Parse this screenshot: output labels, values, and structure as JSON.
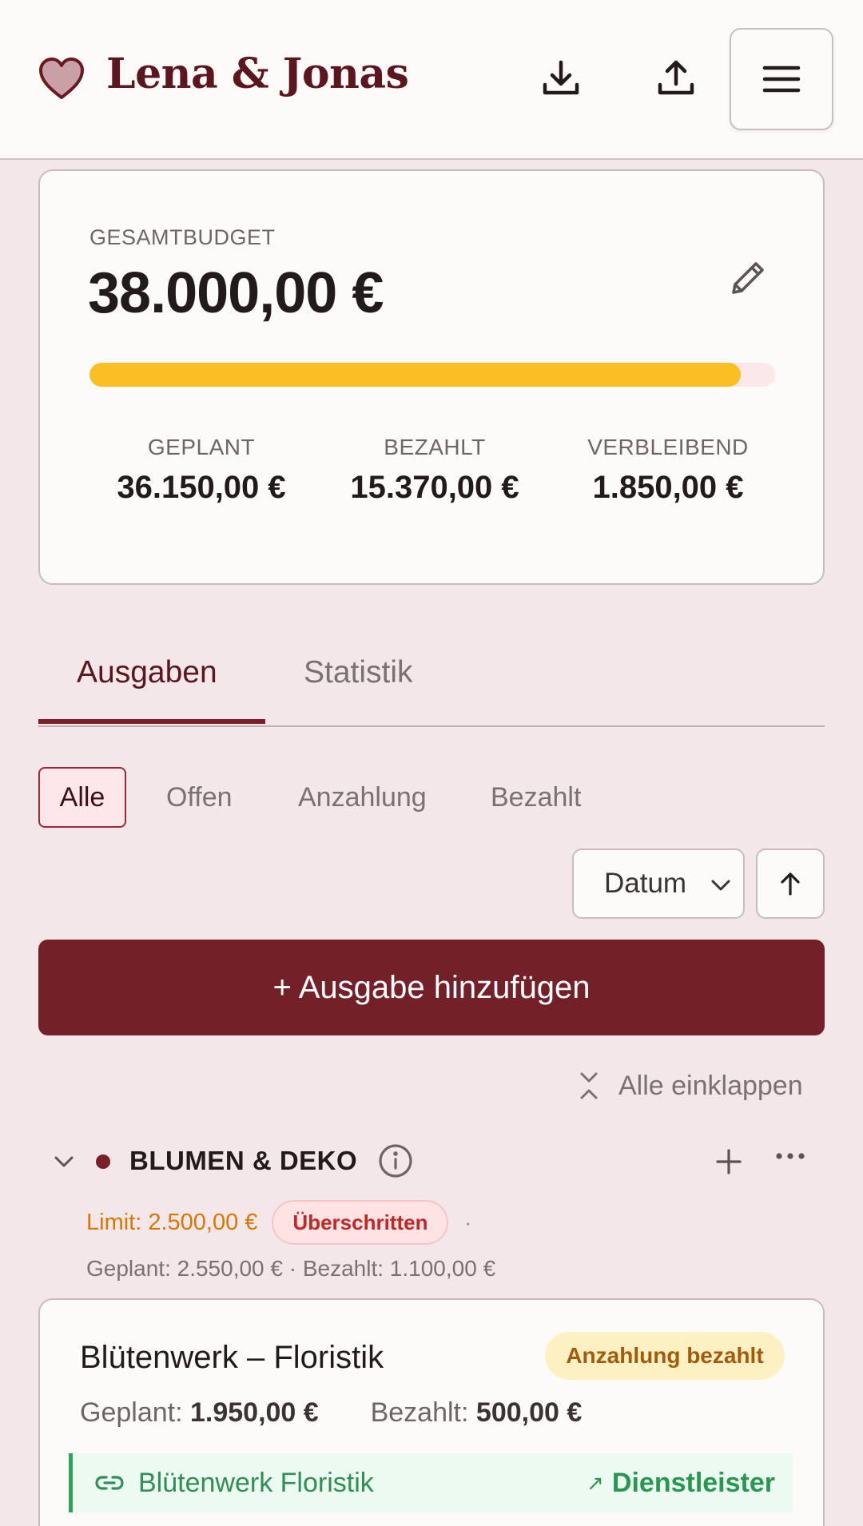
{
  "header": {
    "brand": "Lena & Jonas",
    "icons": [
      "heart-icon",
      "download-icon",
      "upload-icon",
      "menu-icon"
    ]
  },
  "budget": {
    "label": "GESAMTBUDGET",
    "amount": "38.000,00 €",
    "progress_fraction": 0.95,
    "stats": [
      {
        "label": "GEPLANT",
        "value": "36.150,00 €"
      },
      {
        "label": "BEZAHLT",
        "value": "15.370,00 €"
      },
      {
        "label": "VERBLEIBEND",
        "value": "1.850,00 €"
      }
    ]
  },
  "tabs": [
    {
      "label": "Ausgaben",
      "active": true
    },
    {
      "label": "Statistik",
      "active": false
    }
  ],
  "filters": [
    "Alle",
    "Offen",
    "Anzahlung",
    "Bezahlt"
  ],
  "sort": {
    "value": "Datum"
  },
  "add_button": "+ Ausgabe hinzufügen",
  "collapse_all": "Alle einklappen",
  "category": {
    "name": "BLUMEN & DEKO",
    "limit": "Limit: 2.500,00 €",
    "badge": "Überschritten",
    "separator": "·",
    "summary": "Geplant: 2.550,00 € · Bezahlt: 1.100,00 €"
  },
  "item": {
    "title": "Blütenwerk – Floristik",
    "status": "Anzahlung bezahlt",
    "planned_label": "Geplant:",
    "planned_value": "1.950,00 €",
    "paid_label": "Bezahlt:",
    "paid_value": "500,00 €",
    "vendor_name": "Blütenwerk Floristik",
    "vendor_arrow": "↗",
    "vendor_action": "Dienstleister"
  },
  "colors": {
    "brand": "#742028",
    "progress": "#fbbf24",
    "warning": "#d97706",
    "danger": "#c02828",
    "success": "#28984f"
  }
}
